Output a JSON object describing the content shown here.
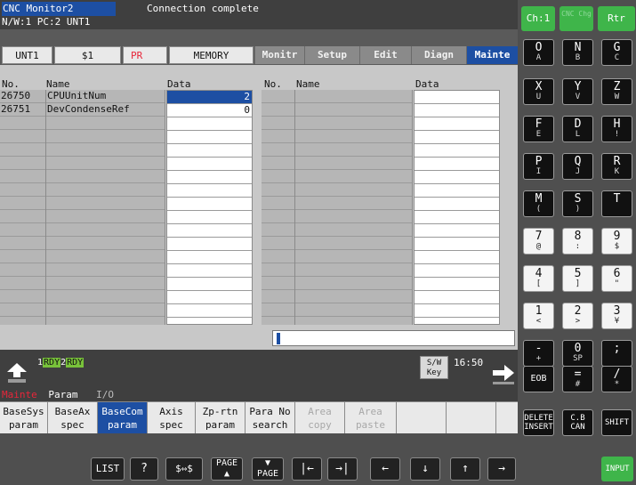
{
  "header": {
    "app_title": "CNC Monitor2",
    "connection_message": "Connection complete",
    "network_info": "N/W:1 PC:2 UNT1"
  },
  "mode_bar": {
    "unit": "UNT1",
    "system": "$1",
    "pr": "PR",
    "mode": "MEMORY"
  },
  "menu_tabs": [
    {
      "label": "Monitr",
      "active": false
    },
    {
      "label": "Setup",
      "active": false
    },
    {
      "label": "Edit",
      "active": false
    },
    {
      "label": "Diagn",
      "active": false
    },
    {
      "label": "Mainte",
      "active": true
    }
  ],
  "table": {
    "headers": {
      "no": "No.",
      "name": "Name",
      "data": "Data"
    },
    "left_rows": [
      {
        "no": "26750",
        "name": "CPUUnitNum",
        "data": "2"
      },
      {
        "no": "26751",
        "name": "DevCondenseRef",
        "data": "0"
      }
    ],
    "right_rows": []
  },
  "status": {
    "rdy1_num": "1",
    "rdy1": "RDY",
    "rdy2_num": "2",
    "rdy2": "RDY",
    "sw_key_line1": "S/W",
    "sw_key_line2": "Key",
    "time": "16:50"
  },
  "menu_path": {
    "current": "Mainte",
    "level2": "Param",
    "level3": "I/O"
  },
  "softkeys": [
    {
      "l1": "BaseSys",
      "l2": "param",
      "state": "normal"
    },
    {
      "l1": "BaseAx",
      "l2": "spec",
      "state": "normal"
    },
    {
      "l1": "BaseCom",
      "l2": "param",
      "state": "active"
    },
    {
      "l1": "Axis",
      "l2": "spec",
      "state": "normal"
    },
    {
      "l1": "Zp-rtn",
      "l2": "param",
      "state": "normal"
    },
    {
      "l1": "Para No",
      "l2": "search",
      "state": "normal"
    },
    {
      "l1": "Area",
      "l2": "copy",
      "state": "disabled"
    },
    {
      "l1": "Area",
      "l2": "paste",
      "state": "disabled"
    },
    {
      "l1": "",
      "l2": "",
      "state": "normal"
    },
    {
      "l1": "",
      "l2": "",
      "state": "normal"
    }
  ],
  "nav_keys": {
    "list": "LIST",
    "help": "?",
    "switch": "$⇔$",
    "page_up": "PAGE ▲",
    "page_down": "▼ PAGE",
    "home": "|←",
    "end": "→|",
    "left": "←",
    "down": "↓",
    "up": "↑",
    "right": "→"
  },
  "keypad": {
    "top_buttons": [
      {
        "label": "Ch:1",
        "dim": false
      },
      {
        "label": "CNC Chg",
        "dim": true
      },
      {
        "label": "Rtr",
        "dim": false
      }
    ],
    "rows": [
      [
        {
          "m": "O",
          "s": "A"
        },
        {
          "m": "N",
          "s": "B"
        },
        {
          "m": "G",
          "s": "C"
        }
      ],
      [
        {
          "m": "X",
          "s": "U"
        },
        {
          "m": "Y",
          "s": "V"
        },
        {
          "m": "Z",
          "s": "W"
        }
      ],
      [
        {
          "m": "F",
          "s": "E"
        },
        {
          "m": "D",
          "s": "L"
        },
        {
          "m": "H",
          "s": "!"
        }
      ],
      [
        {
          "m": "P",
          "s": "I"
        },
        {
          "m": "Q",
          "s": "J"
        },
        {
          "m": "R",
          "s": "K"
        }
      ],
      [
        {
          "m": "M",
          "s": "("
        },
        {
          "m": "S",
          "s": ")"
        },
        {
          "m": "T",
          "s": ""
        }
      ],
      [
        {
          "m": "7",
          "s": "@"
        },
        {
          "m": "8",
          "s": ":"
        },
        {
          "m": "9",
          "s": "$"
        }
      ],
      [
        {
          "m": "4",
          "s": "["
        },
        {
          "m": "5",
          "s": "]"
        },
        {
          "m": "6",
          "s": "\""
        }
      ],
      [
        {
          "m": "1",
          "s": "<"
        },
        {
          "m": "2",
          "s": ">"
        },
        {
          "m": "3",
          "s": "¥"
        }
      ],
      [
        {
          "m": "-",
          "s": "+"
        },
        {
          "m": "0",
          "s": "SP"
        },
        {
          "m": ";",
          "s": ""
        }
      ]
    ],
    "eob": "EOB",
    "eq": {
      "m": "=",
      "s": "#"
    },
    "slash": {
      "m": "/",
      "s": "*"
    },
    "delete_l1": "DELETE",
    "delete_l2": "INSERT",
    "cb_l1": "C.B",
    "cb_l2": "CAN",
    "shift": "SHIFT",
    "input": "INPUT"
  }
}
